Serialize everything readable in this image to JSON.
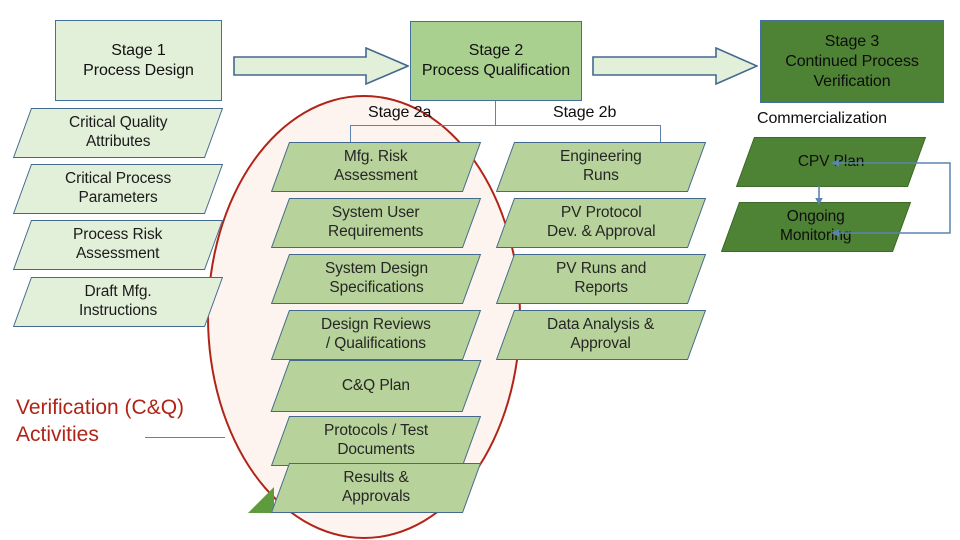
{
  "diagram": {
    "title_present": false,
    "colors": {
      "pale_green": "#e2efd9",
      "mid_green": "#a9d08e",
      "sage_green": "#b7d29a",
      "dark_green": "#4e8234",
      "border_blue": "#44698e",
      "connector_blue": "#5b84b1",
      "ellipse_red": "#b02418",
      "ellipse_fill": "#fdf3ef"
    }
  },
  "stages": {
    "stage1": {
      "label": "Stage 1\nProcess Design"
    },
    "stage2": {
      "label": "Stage 2\nProcess Qualification"
    },
    "stage3": {
      "label": "Stage 3\nContinued Process\nVerification"
    }
  },
  "branch_labels": {
    "stage2a": "Stage 2a",
    "stage2b": "Stage 2b",
    "commercialization": "Commercialization"
  },
  "stage1_items": [
    {
      "label": "Critical Quality\nAttributes"
    },
    {
      "label": "Critical Process\nParameters"
    },
    {
      "label": "Process Risk\nAssessment"
    },
    {
      "label": "Draft Mfg.\nInstructions"
    }
  ],
  "stage2a_items": [
    {
      "label": "Mfg. Risk\nAssessment"
    },
    {
      "label": "System User\nRequirements"
    },
    {
      "label": "System Design\nSpecifications"
    },
    {
      "label": "Design Reviews\n/ Qualifications"
    },
    {
      "label": "C&Q Plan"
    },
    {
      "label": "Protocols / Test\nDocuments"
    },
    {
      "label": "Results &\nApprovals"
    }
  ],
  "stage2b_items": [
    {
      "label": "Engineering\nRuns"
    },
    {
      "label": "PV Protocol\nDev. & Approval"
    },
    {
      "label": "PV Runs and\nReports"
    },
    {
      "label": "Data Analysis &\nApproval"
    }
  ],
  "commercialization_items": [
    {
      "label": "CPV Plan"
    },
    {
      "label": "Ongoing\nMonitoring"
    }
  ],
  "annotation": {
    "verification": "Verification (C&Q)\nActivities"
  }
}
